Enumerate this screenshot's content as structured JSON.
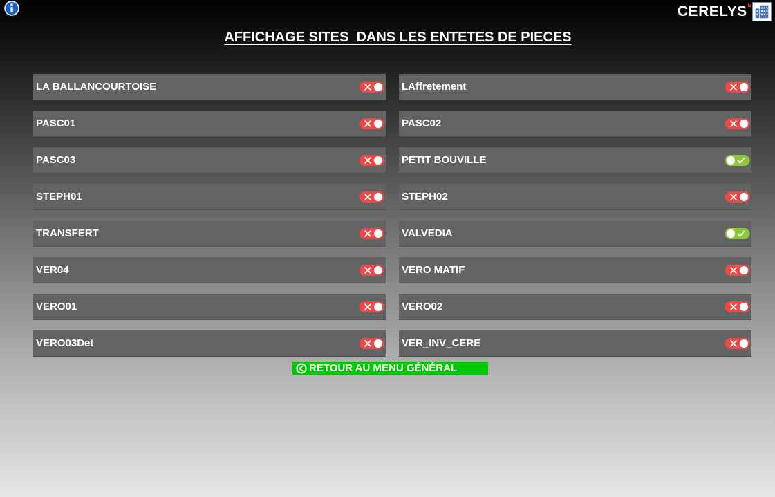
{
  "header": {
    "title": "AFFICHAGE SITES  DANS LES ENTETES DE PIECES",
    "brand": "CERELYS",
    "brand_mark": "E",
    "info_icon": "info-icon",
    "brand_icon": "building-icon"
  },
  "colors": {
    "toggle_off": "#e94b4b",
    "toggle_on": "#8fc63f",
    "back_button": "#00c800",
    "row_background": "#636363"
  },
  "sites": [
    {
      "name": "LA BALLANCOURTOISE",
      "enabled": false
    },
    {
      "name": "LAffretement",
      "enabled": false
    },
    {
      "name": "PASC01",
      "enabled": false
    },
    {
      "name": "PASC02",
      "enabled": false
    },
    {
      "name": "PASC03",
      "enabled": false
    },
    {
      "name": "PETIT BOUVILLE",
      "enabled": true
    },
    {
      "name": "STEPH01",
      "enabled": false
    },
    {
      "name": "STEPH02",
      "enabled": false
    },
    {
      "name": "TRANSFERT",
      "enabled": false
    },
    {
      "name": "VALVEDIA",
      "enabled": true
    },
    {
      "name": "VER04",
      "enabled": false
    },
    {
      "name": "VERO MATIF",
      "enabled": false
    },
    {
      "name": "VERO01",
      "enabled": false
    },
    {
      "name": "VERO02",
      "enabled": false
    },
    {
      "name": "VERO03Det",
      "enabled": false
    },
    {
      "name": "VER_INV_CERE",
      "enabled": false
    }
  ],
  "footer": {
    "back_label": "RETOUR AU MENU GÉNÉRAL",
    "back_icon": "back-arrow-icon"
  }
}
